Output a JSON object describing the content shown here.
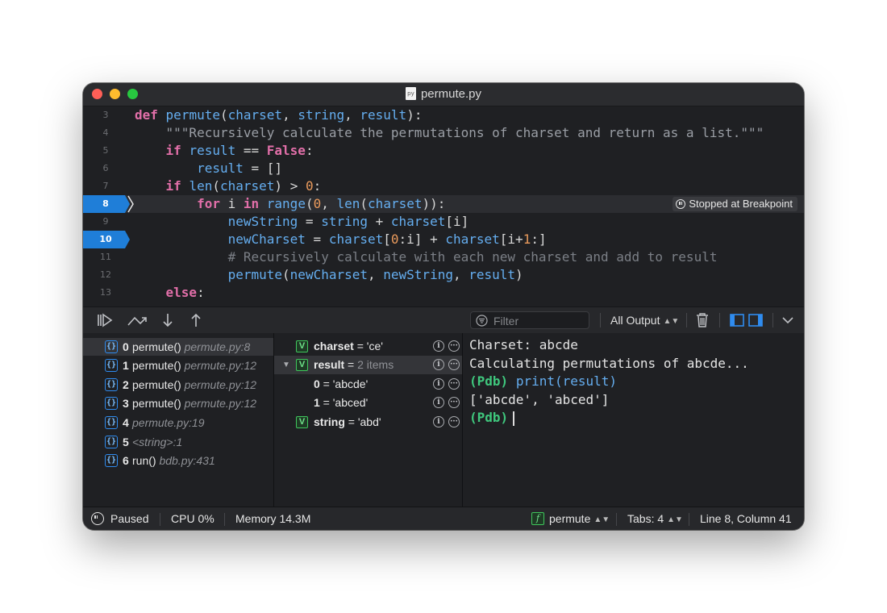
{
  "window": {
    "title": "permute.py",
    "file_icon": "py"
  },
  "editor": {
    "lines": [
      {
        "num": "3",
        "code": "def permute(charset, string, result):"
      },
      {
        "num": "4",
        "code": "    \"\"\"Recursively calculate the permutations of charset and return as a list.\"\"\""
      },
      {
        "num": "5",
        "code": "    if result == False:"
      },
      {
        "num": "6",
        "code": "        result = []"
      },
      {
        "num": "7",
        "code": "    if len(charset) > 0:"
      },
      {
        "num": "8",
        "code": "        for i in range(0, len(charset)):"
      },
      {
        "num": "9",
        "code": "            newString = string + charset[i]"
      },
      {
        "num": "10",
        "code": "            newCharset = charset[0:i] + charset[i+1:]"
      },
      {
        "num": "11",
        "code": "            # Recursively calculate with each new charset and add to result"
      },
      {
        "num": "12",
        "code": "            permute(newCharset, newString, result)"
      },
      {
        "num": "13",
        "code": "    else:"
      }
    ],
    "breakpoint_badge": "Stopped at Breakpoint"
  },
  "debug_toolbar": {
    "filter_placeholder": "Filter",
    "output_select": "All Output"
  },
  "call_stack": [
    {
      "idx": "0",
      "func": "permute()",
      "loc": "permute.py:8"
    },
    {
      "idx": "1",
      "func": "permute()",
      "loc": "permute.py:12"
    },
    {
      "idx": "2",
      "func": "permute()",
      "loc": "permute.py:12"
    },
    {
      "idx": "3",
      "func": "permute()",
      "loc": "permute.py:12"
    },
    {
      "idx": "4",
      "func": "",
      "loc": "permute.py:19"
    },
    {
      "idx": "5",
      "func": "",
      "loc": "<string>:1"
    },
    {
      "idx": "6",
      "func": "run()",
      "loc": "bdb.py:431"
    }
  ],
  "variables": [
    {
      "badge": "V",
      "name": "charset",
      "value": " = 'ce'"
    },
    {
      "badge": "V",
      "name": "result",
      "value": " = ",
      "meta": "2 items"
    },
    {
      "name": "0",
      "value": " = 'abcde'"
    },
    {
      "name": "1",
      "value": " = 'abced'"
    },
    {
      "badge": "V",
      "name": "string",
      "value": " = 'abd'"
    }
  ],
  "console": {
    "lines": [
      "Charset: abcde",
      "Calculating permutations of abcde...",
      "print(result)",
      "['abcde', 'abced']"
    ],
    "prompt": "(Pdb)"
  },
  "statusbar": {
    "state": "Paused",
    "cpu": "CPU 0%",
    "memory": "Memory 14.3M",
    "function_badge": "f",
    "function": "permute",
    "tabs": "Tabs: 4",
    "position": "Line 8, Column 41"
  }
}
